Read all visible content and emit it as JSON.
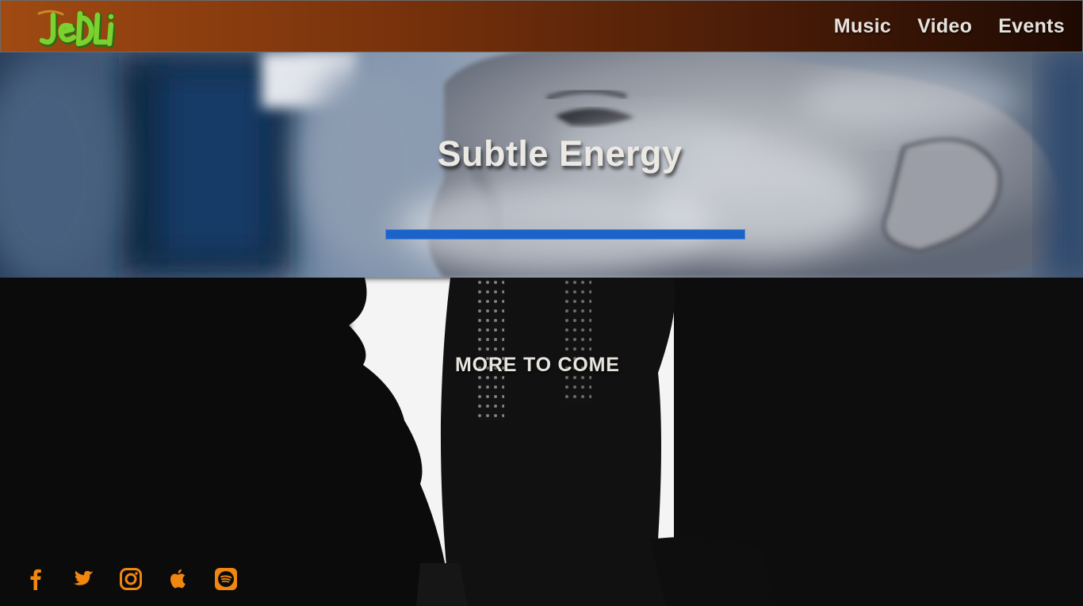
{
  "header": {
    "logo_text": "JeDLi",
    "nav": [
      {
        "label": "Music"
      },
      {
        "label": "Video"
      },
      {
        "label": "Events"
      }
    ]
  },
  "hero": {
    "title": "Subtle Energy",
    "accent_color": "#1c63c9"
  },
  "lower": {
    "message": "MORE TO COME"
  },
  "social": {
    "icon_color": "#f0870f",
    "icons": [
      "facebook-icon",
      "twitter-icon",
      "instagram-icon",
      "apple-music-icon",
      "spotify-icon"
    ]
  },
  "colors": {
    "header_start": "#a04a12",
    "header_end": "#1e0a03",
    "nav_text": "#e6e2dc",
    "logo_green": "#6cc22a"
  }
}
